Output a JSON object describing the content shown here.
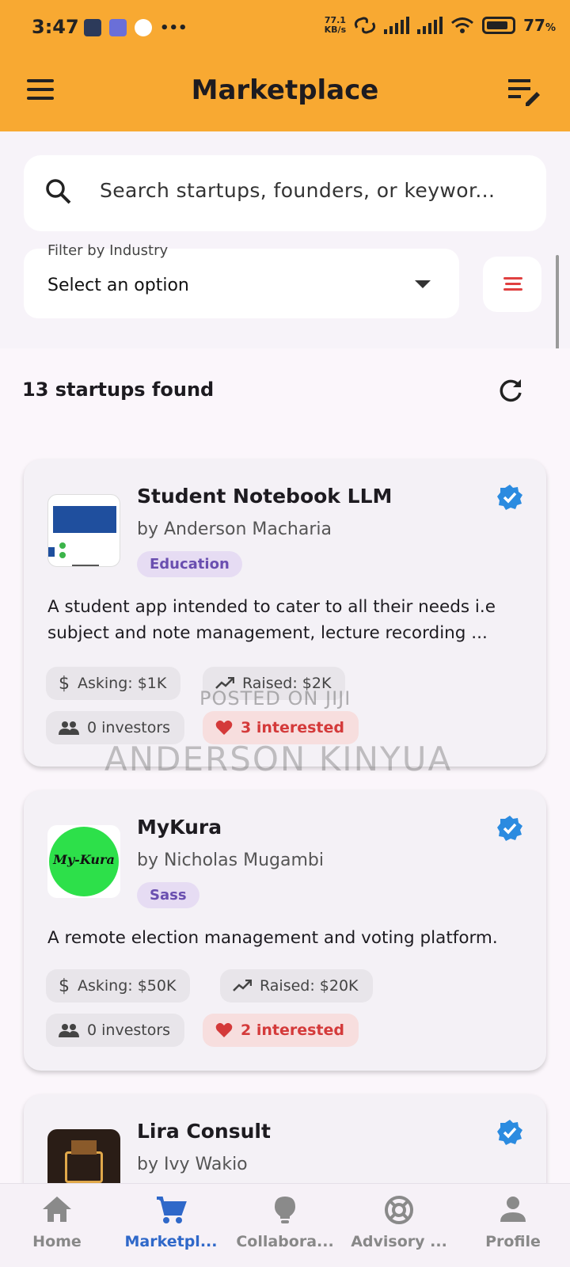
{
  "status_bar": {
    "time": "3:47",
    "net_speed_value": "77.1",
    "net_speed_unit": "KB/s",
    "battery": "77",
    "battery_unit": "%"
  },
  "header": {
    "title": "Marketplace",
    "menu_icon": "hamburger-menu-icon",
    "filter_icon": "filter-list-edit-icon",
    "bg_color": "#f8a932"
  },
  "search": {
    "placeholder": "Search startups, founders, or keywor..."
  },
  "filter": {
    "label": "Filter by Industry",
    "value": "Select an option"
  },
  "results": {
    "count_text": "13 startups found"
  },
  "startups": [
    {
      "name": "Student Notebook LLM",
      "founder": "by Anderson  Macharia",
      "industry": "Education",
      "description": "A student app intended to cater to all their needs i.e subject and note management, lecture recording ...",
      "asking": "Asking: $1K",
      "raised": "Raised: $2K",
      "investors": "0 investors",
      "interested": "3 interested",
      "verified": true
    },
    {
      "name": "MyKura",
      "founder": "by Nicholas Mugambi",
      "industry": "Sass",
      "logo_text": "My-Kura",
      "description": "A remote election management and voting platform.",
      "asking": "Asking: $50K",
      "raised": "Raised: $20K",
      "investors": "0 investors",
      "interested": "2 interested",
      "verified": true
    },
    {
      "name": "Lira Consult",
      "founder": "by Ivy Wakio",
      "verified": true
    }
  ],
  "watermark": {
    "line1": "POSTED ON JIJI",
    "line2": "ANDERSON KINYUA"
  },
  "bottom_nav": [
    {
      "label": "Home",
      "icon": "home-icon",
      "active": false
    },
    {
      "label": "Marketpl...",
      "icon": "cart-icon",
      "active": true
    },
    {
      "label": "Collabora...",
      "icon": "lightbulb-icon",
      "active": false
    },
    {
      "label": "Advisory ...",
      "icon": "support-icon",
      "active": false
    },
    {
      "label": "Profile",
      "icon": "person-icon",
      "active": false
    }
  ],
  "colors": {
    "accent": "#2f68c9",
    "tag_bg": "#e6dcf3",
    "heart": "#d43a3a",
    "verified": "#2b8be0"
  }
}
